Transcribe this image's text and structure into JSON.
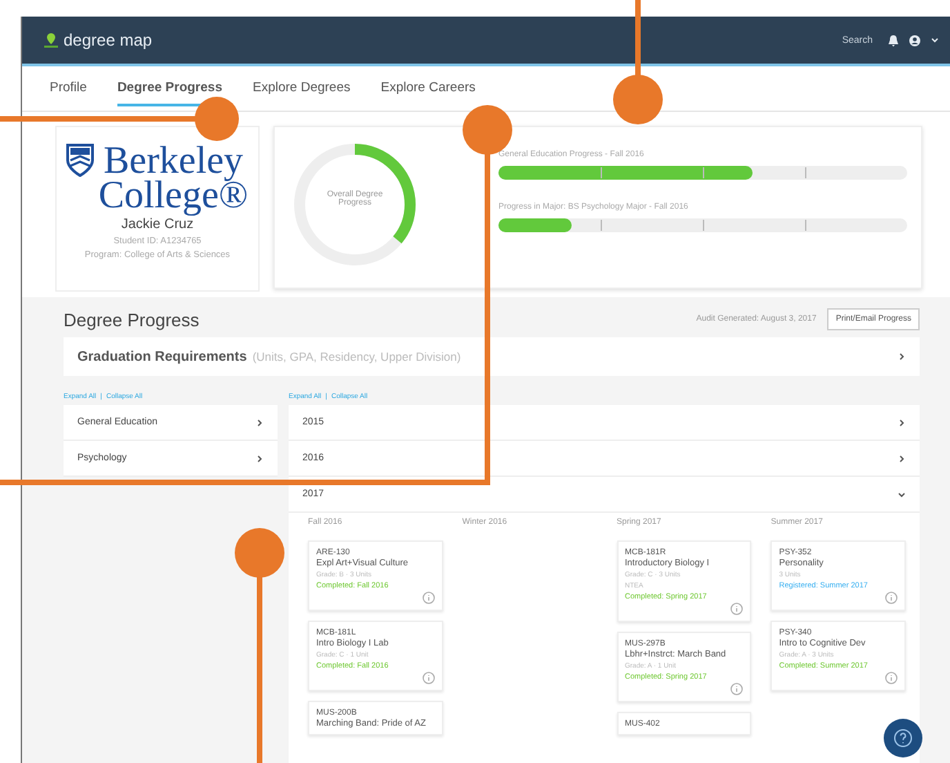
{
  "navbar": {
    "brand": "degree map",
    "search": "Search"
  },
  "tabs": [
    {
      "label": "Profile",
      "selected": false
    },
    {
      "label": "Degree Progress",
      "selected": true
    },
    {
      "label": "Explore Degrees",
      "selected": false
    },
    {
      "label": "Explore Careers",
      "selected": false
    }
  ],
  "profile": {
    "logo_line_1": "Berkeley",
    "logo_line_2": "College®",
    "name": "Jackie Cruz",
    "student_id": "Student ID: A1234765",
    "program": "Program: College of Arts & Sciences"
  },
  "overall": {
    "label": "Overall Degree Progress",
    "level": 0.36
  },
  "progress_bars": [
    {
      "label": "General Education Progress - Fall 2016",
      "level": 0.62
    },
    {
      "label": "Progress in Major: BS Psychology Major - Fall 2016",
      "level": 0.18
    }
  ],
  "section": {
    "title": "Degree Progress",
    "audit": "Audit Generated: August 3, 2017",
    "print_button": "Print/Email Progress"
  },
  "graduation": {
    "title": "Graduation Requirements",
    "note": "(Units, GPA, Residency, Upper Division)"
  },
  "left_links": [
    "Expand All",
    "|",
    "Collapse All"
  ],
  "right_links": [
    "Expand All",
    "|",
    "Collapse All"
  ],
  "requirement_groups": [
    {
      "label": "General Education"
    },
    {
      "label": "Psychology"
    }
  ],
  "years": [
    {
      "label": "2015",
      "expanded": false
    },
    {
      "label": "2016",
      "expanded": false
    },
    {
      "label": "2017",
      "expanded": true
    }
  ],
  "terms": [
    {
      "label": "Fall 2016",
      "courses": [
        {
          "code": "ARE-130",
          "title": "Expl Art+Visual Culture",
          "details": [
            "Grade: B · 3 Units"
          ],
          "status": "Completed: Fall 2016",
          "kind": "completed"
        },
        {
          "code": "MCB-181L",
          "title": "Intro Biology I Lab",
          "details": [
            "Grade: C · 1 Unit"
          ],
          "status": "Completed: Fall 2016",
          "kind": "completed"
        },
        {
          "code": "MUS-200B",
          "title": "Marching Band: Pride of AZ",
          "kind": "partial"
        }
      ]
    },
    {
      "label": "Winter 2016"
    },
    {
      "label": "Spring 2017",
      "courses": [
        {
          "code": "MCB-181R",
          "title": "Introductory Biology I",
          "details": [
            "Grade: C · 3 Units",
            "NTEA"
          ],
          "status": "Completed: Spring 2017",
          "kind": "completed"
        },
        {
          "code": "MUS-297B",
          "title": "Lbhr+Instrct: March Band",
          "details": [
            "Grade: A · 1 Unit"
          ],
          "status": "Completed: Spring 2017",
          "kind": "completed"
        },
        {
          "code": "MUS-402",
          "kind": "partial"
        }
      ]
    },
    {
      "label": "Summer 2017",
      "courses": [
        {
          "code": "PSY-352",
          "title": "Personality",
          "details": [
            "3 Units"
          ],
          "status": "Registered: Summer 2017",
          "kind": "registered"
        },
        {
          "code": "PSY-340",
          "title": "Intro to Cognitive Dev",
          "details": [
            "Grade: A · 3 Units"
          ],
          "status": "Completed: Summer 2017",
          "kind": "completed"
        }
      ]
    }
  ]
}
